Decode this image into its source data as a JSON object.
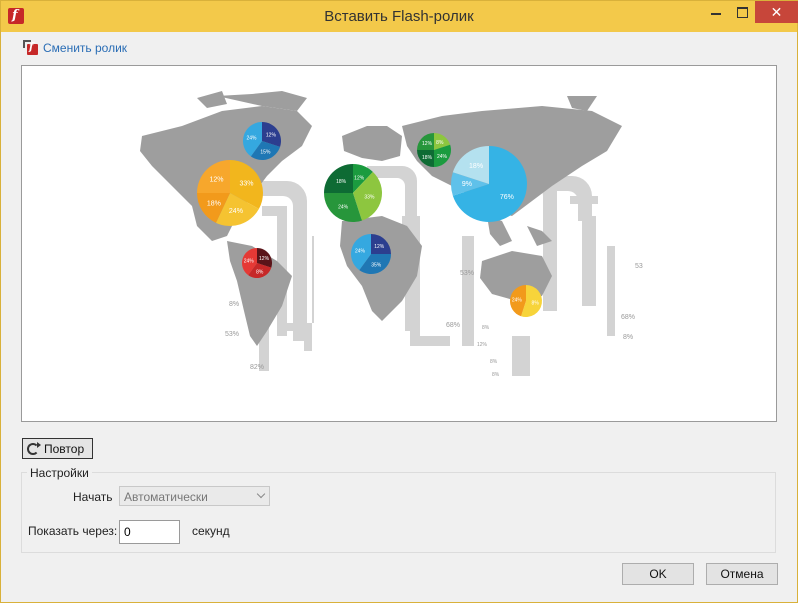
{
  "window": {
    "title": "Вставить Flash-ролик",
    "close_glyph": "✕",
    "app_icon_letter": "f"
  },
  "toolbar": {
    "change_clip_label": "Сменить ролик"
  },
  "preview": {
    "left_labels": [
      "8%",
      "53%",
      "82%"
    ],
    "mid_label": "68%",
    "asia_label": "53%",
    "right_labels": [
      "53",
      "68%",
      "8%"
    ],
    "small_labels": [
      "8%",
      "12%",
      "8%",
      "8%"
    ],
    "pies": [
      {
        "name": "north-america-small",
        "labels": [
          "12%",
          "15%",
          "24%"
        ],
        "colors": [
          "#2c3e8f",
          "#1f77b4",
          "#35a8e0"
        ]
      },
      {
        "name": "north-america-large",
        "labels": [
          "33%",
          "24%",
          "18%",
          "12%"
        ],
        "colors": [
          "#f2b61d",
          "#f5c331",
          "#f29a1b",
          "#f7a72c"
        ]
      },
      {
        "name": "south-america",
        "labels": [
          "12%",
          "8%",
          "24%"
        ],
        "colors": [
          "#5a1419",
          "#c62828",
          "#e53935"
        ]
      },
      {
        "name": "europe",
        "labels": [
          "12%",
          "33%",
          "24%",
          "18%"
        ],
        "colors": [
          "#1b9b3f",
          "#8dc63f",
          "#27963b",
          "#0e6b34"
        ]
      },
      {
        "name": "africa",
        "labels": [
          "12%",
          "35%",
          "24%"
        ],
        "colors": [
          "#2c3e8f",
          "#1f77b4",
          "#35a8e0"
        ]
      },
      {
        "name": "russia",
        "labels": [
          "8%",
          "24%",
          "18%",
          "12%"
        ],
        "colors": [
          "#8dc63f",
          "#1b9b3f",
          "#0e6b34",
          "#27963b"
        ]
      },
      {
        "name": "asia",
        "labels": [
          "76%",
          "9%",
          "18%"
        ],
        "colors": [
          "#35b3e5",
          "#5fc1ea",
          "#b4e1ef"
        ]
      },
      {
        "name": "australia",
        "labels": [
          "8%",
          "24%"
        ],
        "colors": [
          "#f7d43a",
          "#f29a1b"
        ]
      }
    ]
  },
  "replay": {
    "label": "Повтор"
  },
  "settings": {
    "legend": "Настройки",
    "start_label": "Начать",
    "start_value": "Автоматически",
    "show_after_label": "Показать через:",
    "delay_value": "0",
    "seconds_label": "секунд"
  },
  "buttons": {
    "ok": "OK",
    "cancel": "Отмена"
  },
  "colors": {
    "titlebar": "#f3c94a",
    "close": "#c7463a",
    "link": "#2a6db5",
    "map_gray": "#999999",
    "ribbon_gray": "#cfcfcf"
  }
}
